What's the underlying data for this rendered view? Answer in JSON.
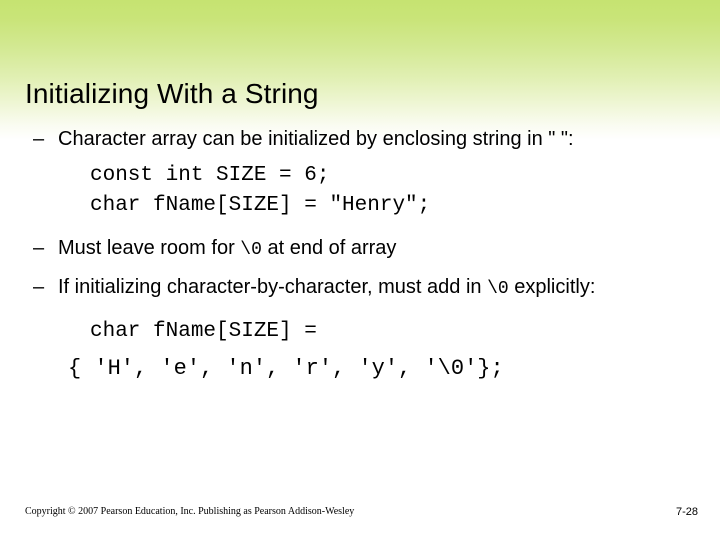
{
  "slide": {
    "title": "Initializing With a String",
    "background": {
      "gradient_top_color": "#c6e371",
      "gradient_bottom_color": "#ffffff"
    },
    "bullets": [
      {
        "marker": "–",
        "text": "Character array can be initialized by enclosing string in \" \":"
      },
      {
        "marker": "–",
        "text_before": "Must leave room for ",
        "mono": "\\0",
        "text_after": " at end of array"
      },
      {
        "marker": "–",
        "text_before": "If initializing character-by-character, must add in ",
        "mono": "\\0",
        "text_after": " explicitly:"
      }
    ],
    "code_blocks": [
      {
        "lines": "const int SIZE = 6;\nchar fName[SIZE] = \"Henry\";"
      },
      {
        "line_1": "char fName[SIZE] =",
        "line_2": "{ 'H', 'e', 'n', 'r', 'y', '\\0'};"
      }
    ]
  },
  "footer": {
    "copyright": "Copyright © 2007 Pearson Education, Inc. Publishing as Pearson Addison-Wesley",
    "page_number": "7-28"
  }
}
